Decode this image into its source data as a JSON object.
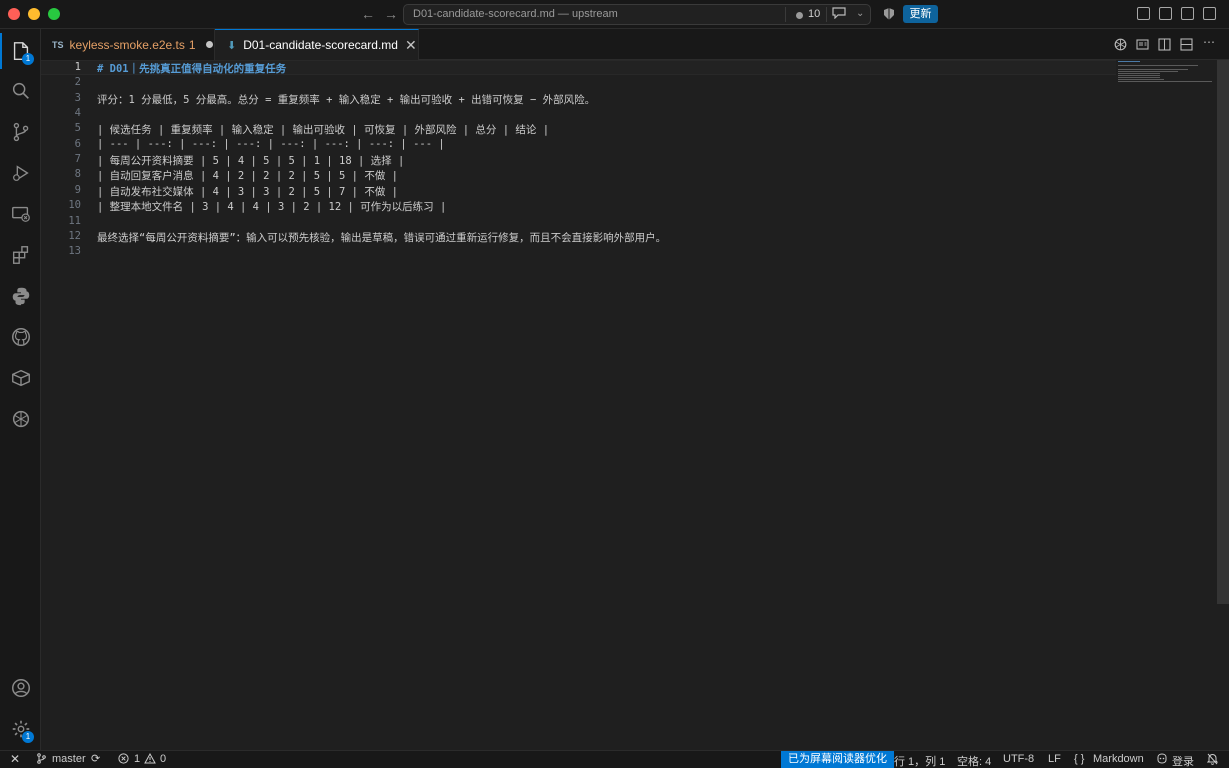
{
  "titlebar": {
    "command_center": "D01-candidate-scorecard.md — upstream",
    "notif_count": "10",
    "update_label": "更新"
  },
  "activity": {
    "explorer_badge": "1",
    "settings_badge": "1"
  },
  "tabs": [
    {
      "icon_text": "TS",
      "label": "keyless-smoke.e2e.ts",
      "problems": "1",
      "modified": true
    },
    {
      "label": "D01-candidate-scorecard.md",
      "active": true
    }
  ],
  "editor": {
    "lines": [
      {
        "n": "1",
        "text": "# D01｜先挑真正值得自动化的重复任务"
      },
      {
        "n": "2",
        "text": ""
      },
      {
        "n": "3",
        "text": "评分：1 分最低，5 分最高。总分 = 重复频率 + 输入稳定 + 输出可验收 + 出错可恢复 − 外部风险。"
      },
      {
        "n": "4",
        "text": ""
      },
      {
        "n": "5",
        "text": "| 候选任务 | 重复频率 | 输入稳定 | 输出可验收 | 可恢复 | 外部风险 | 总分 | 结论 |"
      },
      {
        "n": "6",
        "text": "| --- | ---: | ---: | ---: | ---: | ---: | ---: | --- |"
      },
      {
        "n": "7",
        "text": "| 每周公开资料摘要 | 5 | 4 | 5 | 5 | 1 | 18 | 选择 |"
      },
      {
        "n": "8",
        "text": "| 自动回复客户消息 | 4 | 2 | 2 | 2 | 5 | 5 | 不做 |"
      },
      {
        "n": "9",
        "text": "| 自动发布社交媒体 | 4 | 3 | 3 | 2 | 5 | 7 | 不做 |"
      },
      {
        "n": "10",
        "text": "| 整理本地文件名 | 3 | 4 | 4 | 3 | 2 | 12 | 可作为以后练习 |"
      },
      {
        "n": "11",
        "text": ""
      },
      {
        "n": "12",
        "text": "最终选择“每周公开资料摘要”：输入可以预先核验，输出是草稿，错误可通过重新运行修复，而且不会直接影响外部用户。"
      },
      {
        "n": "13",
        "text": ""
      }
    ]
  },
  "statusbar": {
    "branch": "master",
    "errors": "1",
    "warnings": "0",
    "screen_reader": "已为屏幕阅读器优化",
    "cursor": "行 1，列 1",
    "spaces": "空格: 4",
    "encoding": "UTF-8",
    "eol": "LF",
    "language": "Markdown",
    "login": "登录"
  },
  "colors": {
    "accent": "#0078d4",
    "editor_bg": "#1f1f1f",
    "heading": "#569cd6",
    "modified_tab": "#e5a066"
  }
}
